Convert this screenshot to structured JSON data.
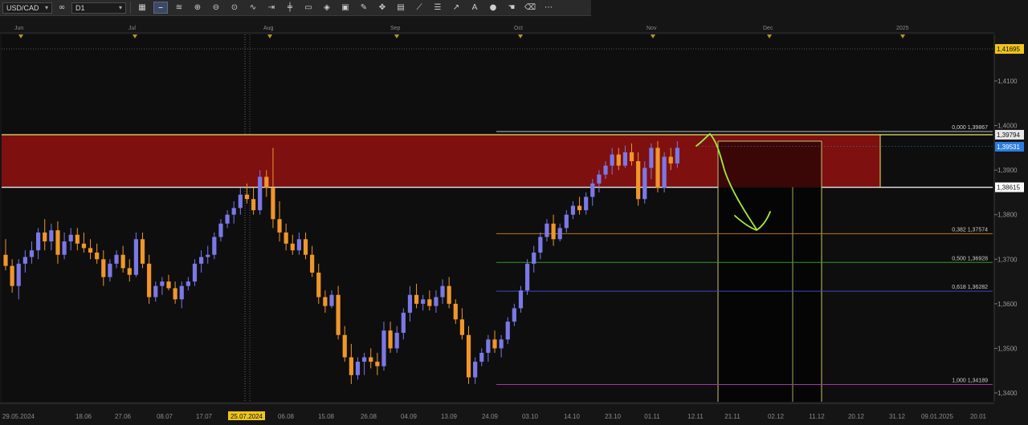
{
  "toolbar": {
    "symbol": "USD/CAD",
    "link": "∞",
    "timeframe": "D1",
    "buttons": [
      {
        "name": "chart-type-icon",
        "glyph": "▦"
      },
      {
        "name": "line-tool-icon",
        "glyph": "⎯",
        "active": true
      },
      {
        "name": "channel-tool-icon",
        "glyph": "≋"
      },
      {
        "name": "zoom-in-icon",
        "glyph": "⊕"
      },
      {
        "name": "zoom-out-icon",
        "glyph": "⊖"
      },
      {
        "name": "zoom-fit-icon",
        "glyph": "⊙"
      },
      {
        "name": "indicator-icon",
        "glyph": "∿"
      },
      {
        "name": "shift-icon",
        "glyph": "⇥"
      },
      {
        "name": "insert-icon",
        "glyph": "╪"
      },
      {
        "name": "note-icon",
        "glyph": "▭"
      },
      {
        "name": "template-icon",
        "glyph": "◈"
      },
      {
        "name": "image-icon",
        "glyph": "▣"
      },
      {
        "name": "pencil-icon",
        "glyph": "✎"
      },
      {
        "name": "crosshair-icon",
        "glyph": "✥"
      },
      {
        "name": "grid-icon",
        "glyph": "▤"
      },
      {
        "name": "ruler-icon",
        "glyph": "⟋"
      },
      {
        "name": "fibo-icon",
        "glyph": "☰"
      },
      {
        "name": "trend-icon",
        "glyph": "↗"
      },
      {
        "name": "text-icon",
        "glyph": "A"
      },
      {
        "name": "shape-icon",
        "glyph": "●"
      },
      {
        "name": "hand-icon",
        "glyph": "☚"
      },
      {
        "name": "eraser-icon",
        "glyph": "⌫"
      },
      {
        "name": "more-icon",
        "glyph": "⋯"
      }
    ]
  },
  "chart_data": {
    "type": "candlestick",
    "symbol": "USD/CAD",
    "timeframe": "D1",
    "ylim": [
      1.3382,
      1.4215
    ],
    "y_ticks": [
      "1,4100",
      "1,4000",
      "1,3900",
      "1,3800",
      "1,3700",
      "1,3600",
      "1,3500",
      "1,3400"
    ],
    "months": [
      "Jun",
      "Jul",
      "Aug",
      "Sep",
      "Oct",
      "Nov",
      "Dec",
      "2025"
    ],
    "date_ticks": [
      "29.05.2024",
      "18.06",
      "27.06",
      "08.07",
      "17.07",
      "25.07.2024",
      "06.08",
      "15.08",
      "26.08",
      "04.09",
      "13.09",
      "24.09",
      "03.10",
      "14.10",
      "23.10",
      "01.11",
      "12.11",
      "21.11",
      "02.12",
      "11.12",
      "20.12",
      "31.12",
      "09.01.2025",
      "20.01"
    ],
    "highlighted_date": "25.07.2024",
    "price_labels": {
      "top": "1,41695",
      "resistance": "1,39794",
      "current": "1,39531",
      "support": "1,38615"
    },
    "fibonacci": [
      {
        "label": "0,000 1,39867",
        "value": 1.39867,
        "color": "#bdbdbd"
      },
      {
        "label": "0,382 1,37574",
        "value": 1.37574,
        "color": "#c0741a"
      },
      {
        "label": "0,500 1,36928",
        "value": 1.36928,
        "color": "#2f9a2f"
      },
      {
        "label": "0,618 1,36282",
        "value": 1.36282,
        "color": "#3a4ab8"
      },
      {
        "label": "1,000 1,34189",
        "value": 1.34189,
        "color": "#a03aa0"
      }
    ],
    "zone": {
      "top": 1.39794,
      "bottom": 1.38615
    },
    "bull_color": "#7b78e6",
    "bear_color": "#f0962a",
    "candles": [
      [
        1.371,
        1.3745,
        1.3675,
        1.3685
      ],
      [
        1.3685,
        1.37,
        1.3625,
        1.364
      ],
      [
        1.364,
        1.37,
        1.361,
        1.369
      ],
      [
        1.369,
        1.372,
        1.367,
        1.3705
      ],
      [
        1.3705,
        1.374,
        1.369,
        1.372
      ],
      [
        1.372,
        1.377,
        1.37,
        1.376
      ],
      [
        1.376,
        1.379,
        1.372,
        1.374
      ],
      [
        1.374,
        1.378,
        1.372,
        1.3765
      ],
      [
        1.3765,
        1.3785,
        1.369,
        1.371
      ],
      [
        1.371,
        1.376,
        1.37,
        1.374
      ],
      [
        1.374,
        1.377,
        1.372,
        1.3755
      ],
      [
        1.3755,
        1.377,
        1.372,
        1.3735
      ],
      [
        1.3735,
        1.376,
        1.3715,
        1.3725
      ],
      [
        1.3725,
        1.3745,
        1.37,
        1.3715
      ],
      [
        1.3715,
        1.3735,
        1.369,
        1.37
      ],
      [
        1.37,
        1.372,
        1.364,
        1.366
      ],
      [
        1.366,
        1.37,
        1.365,
        1.369
      ],
      [
        1.369,
        1.372,
        1.368,
        1.371
      ],
      [
        1.371,
        1.373,
        1.367,
        1.368
      ],
      [
        1.368,
        1.37,
        1.365,
        1.3665
      ],
      [
        1.3665,
        1.376,
        1.366,
        1.3745
      ],
      [
        1.3745,
        1.376,
        1.368,
        1.369
      ],
      [
        1.369,
        1.371,
        1.36,
        1.3615
      ],
      [
        1.3615,
        1.365,
        1.3605,
        1.364
      ],
      [
        1.364,
        1.366,
        1.362,
        1.365
      ],
      [
        1.365,
        1.3665,
        1.363,
        1.3635
      ],
      [
        1.3635,
        1.365,
        1.36,
        1.361
      ],
      [
        1.361,
        1.365,
        1.359,
        1.364
      ],
      [
        1.364,
        1.366,
        1.363,
        1.365
      ],
      [
        1.365,
        1.37,
        1.364,
        1.369
      ],
      [
        1.369,
        1.372,
        1.367,
        1.3705
      ],
      [
        1.3705,
        1.373,
        1.369,
        1.371
      ],
      [
        1.371,
        1.376,
        1.37,
        1.375
      ],
      [
        1.375,
        1.379,
        1.374,
        1.378
      ],
      [
        1.378,
        1.381,
        1.377,
        1.38
      ],
      [
        1.38,
        1.383,
        1.378,
        1.3815
      ],
      [
        1.3815,
        1.386,
        1.38,
        1.3845
      ],
      [
        1.3845,
        1.387,
        1.3825,
        1.3835
      ],
      [
        1.3835,
        1.386,
        1.38,
        1.381
      ],
      [
        1.381,
        1.39,
        1.38,
        1.3885
      ],
      [
        1.3885,
        1.39,
        1.384,
        1.386
      ],
      [
        1.386,
        1.395,
        1.377,
        1.379
      ],
      [
        1.379,
        1.383,
        1.374,
        1.376
      ],
      [
        1.376,
        1.378,
        1.372,
        1.3735
      ],
      [
        1.3735,
        1.3755,
        1.371,
        1.372
      ],
      [
        1.372,
        1.376,
        1.371,
        1.3745
      ],
      [
        1.3745,
        1.376,
        1.37,
        1.371
      ],
      [
        1.371,
        1.373,
        1.366,
        1.367
      ],
      [
        1.367,
        1.369,
        1.36,
        1.3615
      ],
      [
        1.3615,
        1.363,
        1.358,
        1.3595
      ],
      [
        1.3595,
        1.363,
        1.359,
        1.362
      ],
      [
        1.362,
        1.364,
        1.352,
        1.353
      ],
      [
        1.353,
        1.355,
        1.347,
        1.348
      ],
      [
        1.348,
        1.351,
        1.342,
        1.344
      ],
      [
        1.344,
        1.348,
        1.343,
        1.347
      ],
      [
        1.347,
        1.349,
        1.344,
        1.348
      ],
      [
        1.348,
        1.35,
        1.3455,
        1.347
      ],
      [
        1.347,
        1.349,
        1.344,
        1.346
      ],
      [
        1.346,
        1.356,
        1.345,
        1.354
      ],
      [
        1.354,
        1.356,
        1.349,
        1.35
      ],
      [
        1.35,
        1.355,
        1.349,
        1.3535
      ],
      [
        1.3535,
        1.359,
        1.352,
        1.358
      ],
      [
        1.358,
        1.364,
        1.356,
        1.362
      ],
      [
        1.362,
        1.3645,
        1.359,
        1.36
      ],
      [
        1.36,
        1.362,
        1.3585,
        1.361
      ],
      [
        1.361,
        1.363,
        1.3585,
        1.3595
      ],
      [
        1.3595,
        1.363,
        1.358,
        1.3615
      ],
      [
        1.3615,
        1.3655,
        1.36,
        1.364
      ],
      [
        1.364,
        1.366,
        1.359,
        1.36
      ],
      [
        1.36,
        1.361,
        1.3555,
        1.3565
      ],
      [
        1.3565,
        1.359,
        1.352,
        1.353
      ],
      [
        1.353,
        1.355,
        1.342,
        1.3435
      ],
      [
        1.3435,
        1.348,
        1.342,
        1.347
      ],
      [
        1.347,
        1.35,
        1.346,
        1.349
      ],
      [
        1.349,
        1.353,
        1.347,
        1.352
      ],
      [
        1.352,
        1.354,
        1.349,
        1.35
      ],
      [
        1.35,
        1.353,
        1.348,
        1.352
      ],
      [
        1.352,
        1.357,
        1.351,
        1.356
      ],
      [
        1.356,
        1.36,
        1.355,
        1.359
      ],
      [
        1.359,
        1.364,
        1.358,
        1.363
      ],
      [
        1.363,
        1.37,
        1.362,
        1.369
      ],
      [
        1.369,
        1.373,
        1.367,
        1.3715
      ],
      [
        1.3715,
        1.376,
        1.37,
        1.375
      ],
      [
        1.375,
        1.379,
        1.374,
        1.378
      ],
      [
        1.378,
        1.38,
        1.373,
        1.3745
      ],
      [
        1.3745,
        1.378,
        1.374,
        1.377
      ],
      [
        1.377,
        1.381,
        1.376,
        1.38
      ],
      [
        1.38,
        1.383,
        1.379,
        1.382
      ],
      [
        1.382,
        1.384,
        1.38,
        1.381
      ],
      [
        1.381,
        1.385,
        1.38,
        1.384
      ],
      [
        1.384,
        1.388,
        1.382,
        1.387
      ],
      [
        1.387,
        1.39,
        1.385,
        1.389
      ],
      [
        1.389,
        1.392,
        1.388,
        1.391
      ],
      [
        1.391,
        1.395,
        1.389,
        1.3935
      ],
      [
        1.3935,
        1.395,
        1.39,
        1.391
      ],
      [
        1.391,
        1.3955,
        1.3905,
        1.394
      ],
      [
        1.394,
        1.396,
        1.391,
        1.392
      ],
      [
        1.392,
        1.394,
        1.382,
        1.3835
      ],
      [
        1.3835,
        1.392,
        1.3825,
        1.3905
      ],
      [
        1.3905,
        1.396,
        1.388,
        1.395
      ],
      [
        1.395,
        1.3965,
        1.385,
        1.386
      ],
      [
        1.386,
        1.394,
        1.385,
        1.393
      ],
      [
        1.393,
        1.395,
        1.39,
        1.3915
      ],
      [
        1.3915,
        1.3965,
        1.3905,
        1.395
      ]
    ]
  }
}
